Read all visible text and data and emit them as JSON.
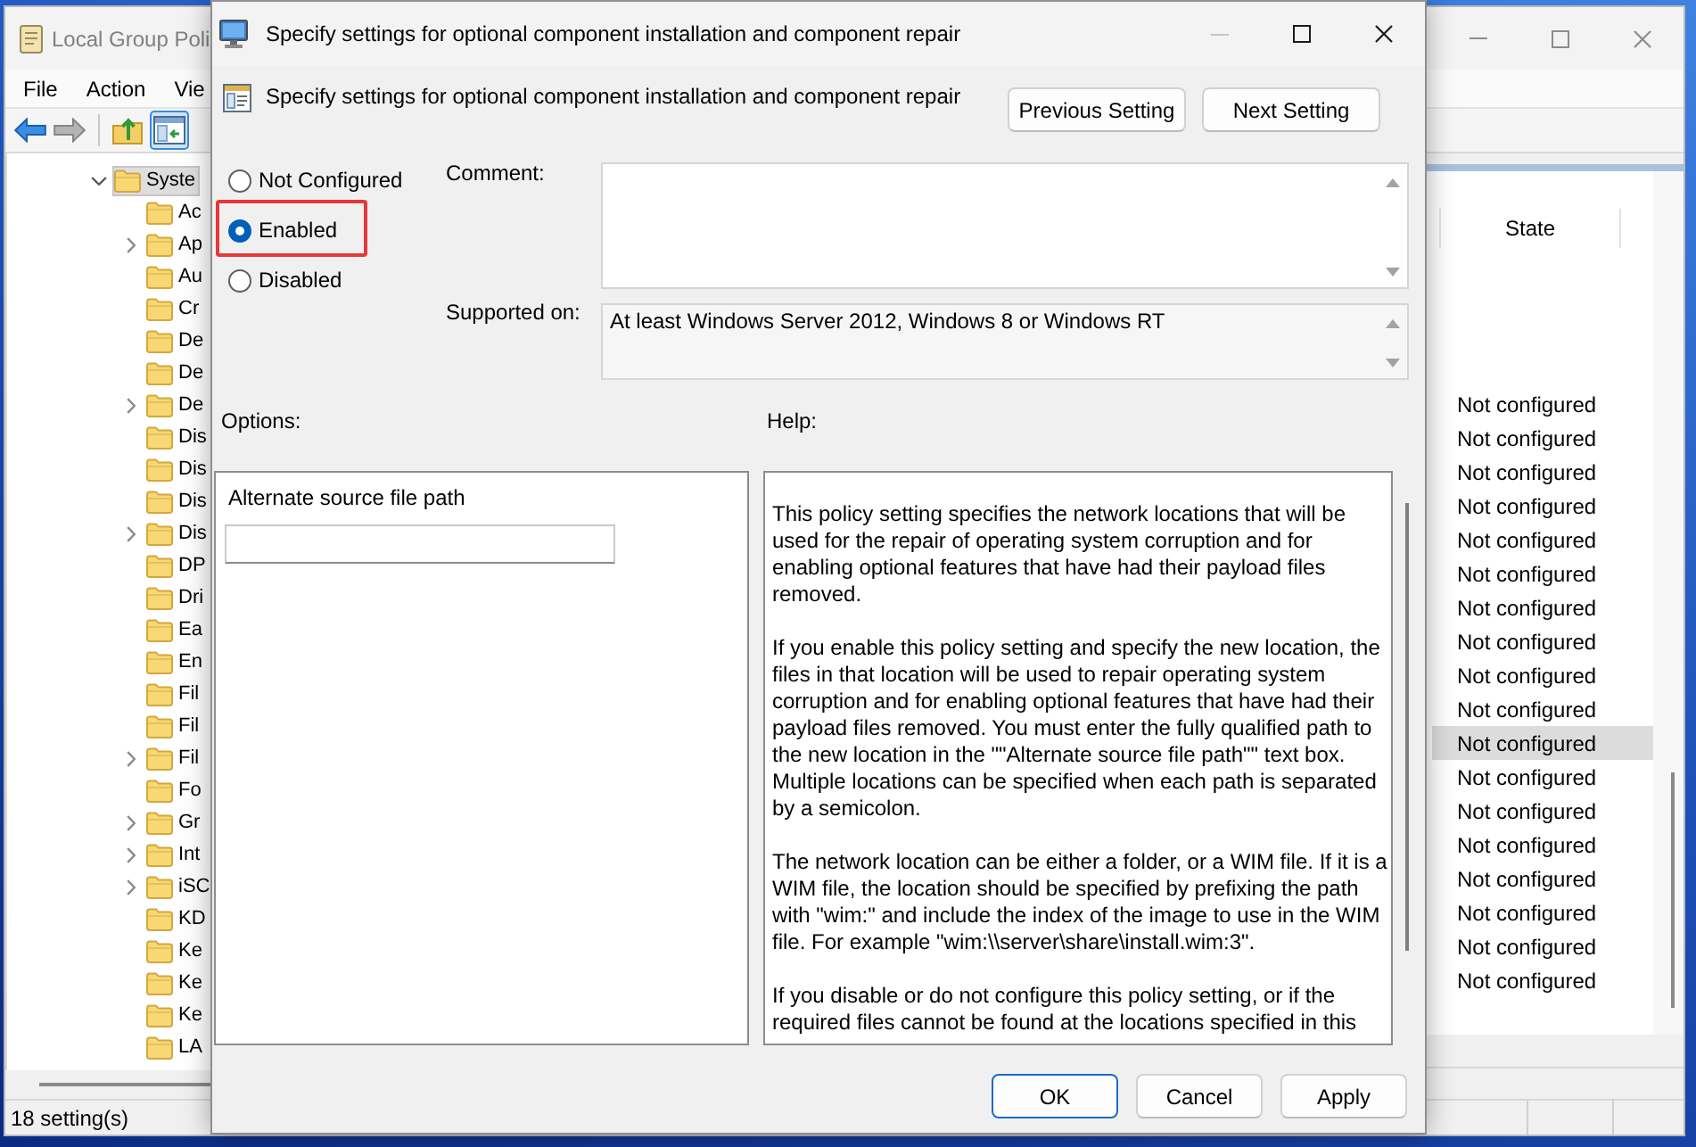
{
  "background_window": {
    "title": "Local Group Poli",
    "active": false,
    "controls": [
      {
        "kind": "minimize",
        "disabled": false
      },
      {
        "kind": "maximize",
        "disabled": false
      },
      {
        "kind": "close",
        "disabled": false
      }
    ],
    "menu": [
      "File",
      "Action",
      "Vie"
    ],
    "toolbar": [
      {
        "kind": "back",
        "disabled": false,
        "pressed": false
      },
      {
        "kind": "forward",
        "disabled": true,
        "pressed": false
      },
      {
        "kind": "separator"
      },
      {
        "kind": "up",
        "disabled": false,
        "pressed": false
      },
      {
        "kind": "tree",
        "disabled": false,
        "pressed": true
      }
    ],
    "tree": [
      {
        "label": "Syste",
        "expanded": true,
        "selected": true,
        "children": [
          {
            "label": "Ac",
            "expandable": false,
            "expanded": false,
            "selected": false
          },
          {
            "label": "Ap",
            "expandable": true,
            "expanded": false,
            "selected": false
          },
          {
            "label": "Au",
            "expandable": false,
            "expanded": false,
            "selected": false
          },
          {
            "label": "Cr",
            "expandable": false,
            "expanded": false,
            "selected": false
          },
          {
            "label": "De",
            "expandable": false,
            "expanded": false,
            "selected": false
          },
          {
            "label": "De",
            "expandable": false,
            "expanded": false,
            "selected": false
          },
          {
            "label": "De",
            "expandable": true,
            "expanded": false,
            "selected": false
          },
          {
            "label": "Dis",
            "expandable": false,
            "expanded": false,
            "selected": false
          },
          {
            "label": "Dis",
            "expandable": false,
            "expanded": false,
            "selected": false
          },
          {
            "label": "Dis",
            "expandable": false,
            "expanded": false,
            "selected": false
          },
          {
            "label": "Dis",
            "expandable": true,
            "expanded": false,
            "selected": false
          },
          {
            "label": "DP",
            "expandable": false,
            "expanded": false,
            "selected": false
          },
          {
            "label": "Dri",
            "expandable": false,
            "expanded": false,
            "selected": false
          },
          {
            "label": "Ea",
            "expandable": false,
            "expanded": false,
            "selected": false
          },
          {
            "label": "En",
            "expandable": false,
            "expanded": false,
            "selected": false
          },
          {
            "label": "Fil",
            "expandable": false,
            "expanded": false,
            "selected": false
          },
          {
            "label": "Fil",
            "expandable": false,
            "expanded": false,
            "selected": false
          },
          {
            "label": "Fil",
            "expandable": true,
            "expanded": false,
            "selected": false
          },
          {
            "label": "Fo",
            "expandable": false,
            "expanded": false,
            "selected": false
          },
          {
            "label": "Gr",
            "expandable": true,
            "expanded": false,
            "selected": false
          },
          {
            "label": "Int",
            "expandable": true,
            "expanded": false,
            "selected": false
          },
          {
            "label": "iSC",
            "expandable": true,
            "expanded": false,
            "selected": false
          },
          {
            "label": "KD",
            "expandable": false,
            "expanded": false,
            "selected": false
          },
          {
            "label": "Ke",
            "expandable": false,
            "expanded": false,
            "selected": false
          },
          {
            "label": "Ke",
            "expandable": false,
            "expanded": false,
            "selected": false
          },
          {
            "label": "Ke",
            "expandable": false,
            "expanded": false,
            "selected": false
          },
          {
            "label": "LA",
            "expandable": false,
            "expanded": false,
            "selected": false
          }
        ]
      }
    ],
    "list": {
      "columns": [
        "State"
      ],
      "rows": [
        {
          "state": "Not configured",
          "selected": false
        },
        {
          "state": "Not configured",
          "selected": false
        },
        {
          "state": "Not configured",
          "selected": false
        },
        {
          "state": "Not configured",
          "selected": false
        },
        {
          "state": "Not configured",
          "selected": false
        },
        {
          "state": "Not configured",
          "selected": false
        },
        {
          "state": "Not configured",
          "selected": false
        },
        {
          "state": "Not configured",
          "selected": false
        },
        {
          "state": "Not configured",
          "selected": false
        },
        {
          "state": "Not configured",
          "selected": false
        },
        {
          "state": "Not configured",
          "selected": true
        },
        {
          "state": "Not configured",
          "selected": false
        },
        {
          "state": "Not configured",
          "selected": false
        },
        {
          "state": "Not configured",
          "selected": false
        },
        {
          "state": "Not configured",
          "selected": false
        },
        {
          "state": "Not configured",
          "selected": false
        },
        {
          "state": "Not configured",
          "selected": false
        },
        {
          "state": "Not configured",
          "selected": false
        }
      ]
    },
    "status_bar": "18 setting(s)"
  },
  "dialog": {
    "title": "Specify settings for optional component installation and component repair",
    "active": true,
    "controls": [
      {
        "kind": "minimize",
        "disabled": true
      },
      {
        "kind": "maximize",
        "disabled": false
      },
      {
        "kind": "close",
        "disabled": false
      }
    ],
    "heading": "Specify settings for optional component installation and component repair",
    "nav_buttons": [
      "Previous Setting",
      "Next Setting"
    ],
    "options": [
      {
        "label": "Not Configured",
        "selected": false,
        "highlighted": false
      },
      {
        "label": "Enabled",
        "selected": true,
        "highlighted": true
      },
      {
        "label": "Disabled",
        "selected": false,
        "highlighted": false
      }
    ],
    "comment": {
      "label": "Comment:"
    },
    "supported_on": {
      "label": "Supported on:",
      "value": "At least Windows Server 2012, Windows 8 or Windows RT"
    },
    "options_panel": {
      "label": "Options:",
      "fields": [
        {
          "label": "Alternate source file path"
        }
      ]
    },
    "help_panel": {
      "label": "Help:",
      "paragraphs": [
        "This policy setting specifies the network locations that will be used for the repair of operating system corruption and for enabling optional features that have had their payload files removed.",
        "If you enable this policy setting and specify the new location, the files in that location will be used to repair operating system corruption and for enabling optional features that have had their payload files removed. You must enter the fully qualified path to the new location in the \"\"Alternate source file path\"\" text box. Multiple locations can be specified when each path is separated by a semicolon.",
        "The network location can be either a folder, or a WIM file. If it is a WIM file, the location should be specified by prefixing the path with \"wim:\" and include the index of the image to use in the WIM file. For example \"wim:\\\\server\\share\\install.wim:3\".",
        "If you disable or do not configure this policy setting, or if the required files cannot be found at the locations specified in this"
      ]
    },
    "buttons": [
      {
        "label": "OK",
        "focused": true
      },
      {
        "label": "Cancel",
        "focused": false
      },
      {
        "label": "Apply",
        "focused": false
      }
    ]
  }
}
